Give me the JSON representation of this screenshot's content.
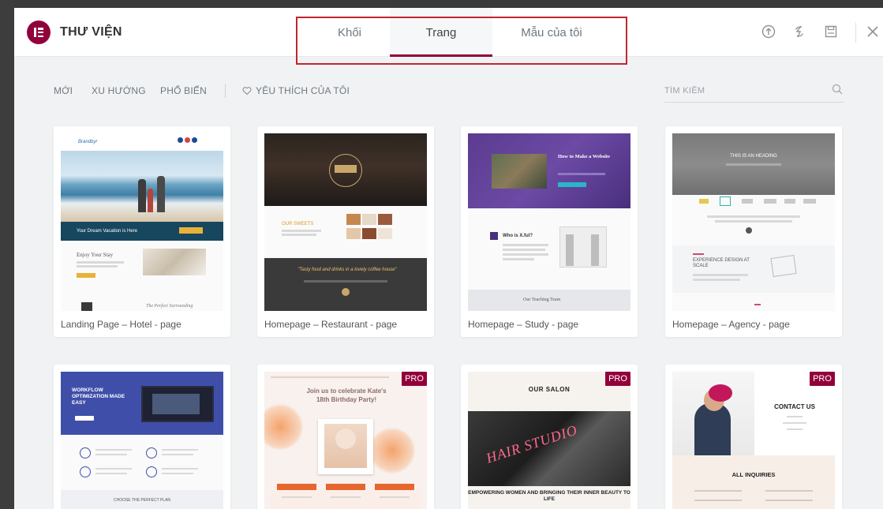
{
  "header": {
    "title": "THƯ VIỆN",
    "tabs": [
      {
        "label": "Khối"
      },
      {
        "label": "Trang"
      },
      {
        "label": "Mẫu của tôi"
      }
    ],
    "active_tab": "Trang"
  },
  "filters": {
    "items": [
      "MỚI",
      "XU HƯỚNG",
      "PHỔ BIẾN"
    ],
    "favorites": "YÊU THÍCH CỦA TÔI"
  },
  "search": {
    "placeholder": "TÌM KIẾM"
  },
  "templates": [
    {
      "name": "Landing Page – Hotel - page",
      "thumb_texts": [
        "Your Dream Vacation is Here",
        "Enjoy Your Stay",
        "The Perfect Surrounding"
      ]
    },
    {
      "name": "Homepage – Restaurant - page",
      "thumb_texts": [
        "OUR SWEETS",
        "\"Tasty food and drinks in a lovely coffee house\""
      ]
    },
    {
      "name": "Homepage – Study - page",
      "thumb_texts": [
        "How to Make a Website",
        "Who is X.ful?",
        "Our Teaching Team"
      ]
    },
    {
      "name": "Homepage – Agency - page",
      "thumb_texts": [
        "THIS IS AN HEADING",
        "EXPERIENCE DESIGN AT SCALE"
      ]
    },
    {
      "name": "",
      "thumb_texts": [
        "WORKFLOW OPTIMIZATION MADE EASY",
        "CHOOSE THE PERFECT PLAN"
      ]
    },
    {
      "name": "",
      "pro": "PRO",
      "thumb_texts": [
        "Join us to celebrate Kate's",
        "18th Birthday Party!"
      ]
    },
    {
      "name": "",
      "pro": "PRO",
      "thumb_texts": [
        "OUR SALON",
        "HAIR STUDIO",
        "EMPOWERING WOMEN AND BRINGING THEIR INNER BEAUTY TO LIFE"
      ]
    },
    {
      "name": "",
      "pro": "PRO",
      "thumb_texts": [
        "CONTACT US",
        "ALL INQUIRIES"
      ]
    }
  ],
  "colors": {
    "brand": "#92003b",
    "highlight": "#c0272d",
    "pro_badge": "#92003b"
  },
  "icons": {
    "logo": "elementor-logo-icon",
    "upload": "upload-icon",
    "sync": "sync-icon",
    "save": "save-icon",
    "close": "close-icon",
    "favorite": "heart-icon",
    "search": "search-icon"
  }
}
